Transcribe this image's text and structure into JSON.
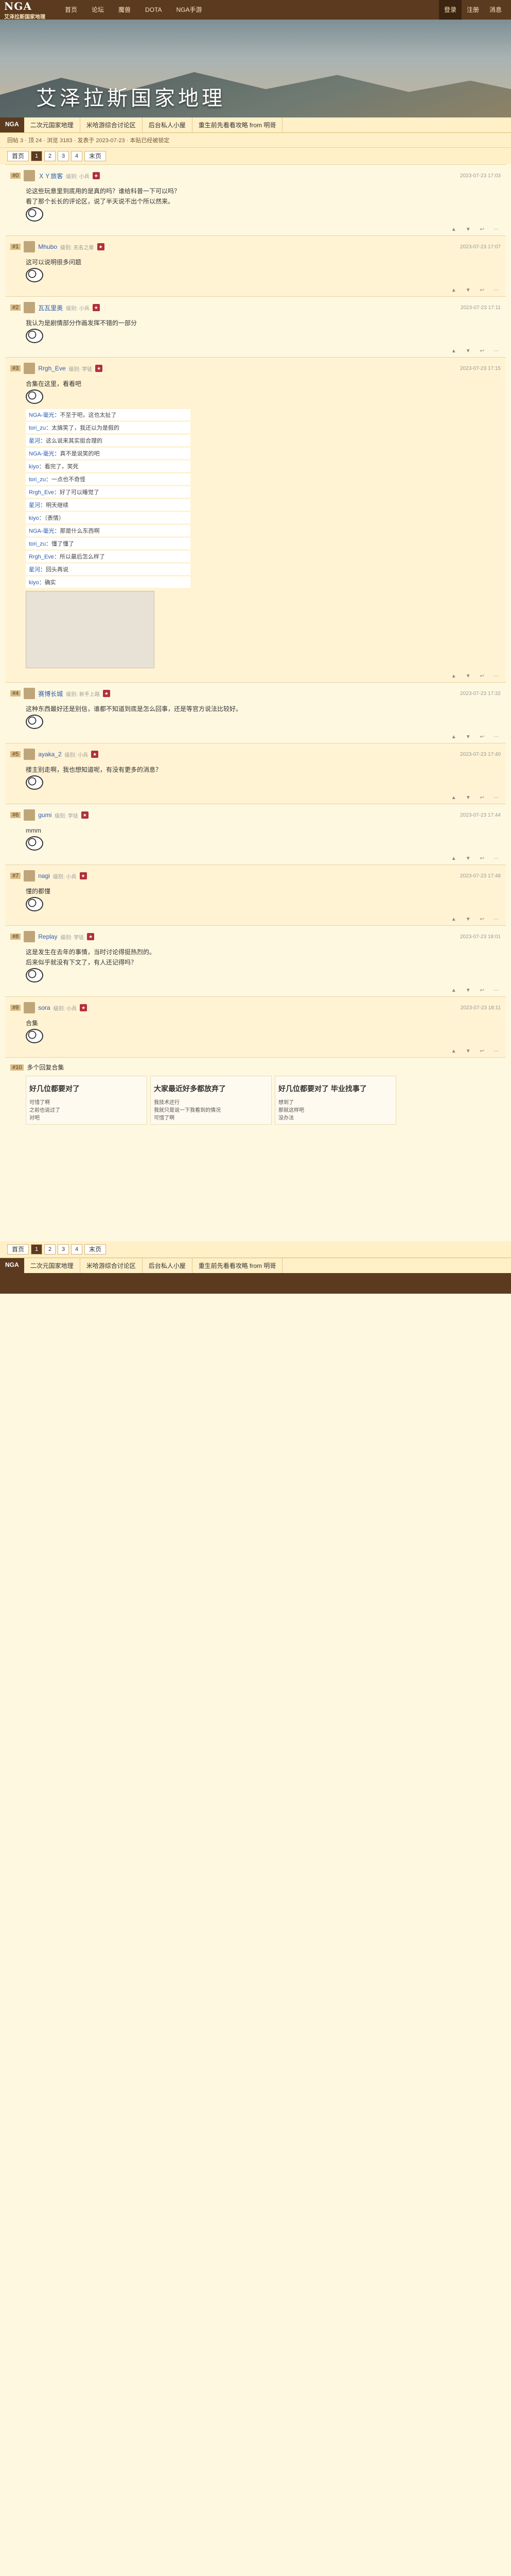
{
  "site": {
    "logo": "NGA",
    "logo_sub": "艾泽拉斯国家地理",
    "nav": [
      "首页",
      "论坛",
      "魔兽",
      "DOTA",
      "NGA手游"
    ],
    "right": [
      "登录",
      "注册",
      "消息"
    ],
    "banner_title": "艾泽拉斯国家地理"
  },
  "tabs": {
    "home": "NGA",
    "items": [
      "二次元国家地理",
      "米哈游综合讨论区",
      "后台私人小屋",
      "重生前先看看攻略 from 明哥"
    ]
  },
  "postinfo": "回帖 3 · 顶 24 · 浏览 3183 · 发表于 2023-07-23 · 本贴已经被锁定",
  "pager": {
    "first": "首页",
    "pages": [
      "1",
      "2",
      "3",
      "4"
    ],
    "last": "末页"
  },
  "posts": [
    {
      "floor": "#0",
      "user": "ＸＹ旅客",
      "level": "级别: 小兵",
      "time": "2023-07-23 17:03",
      "lines": [
        "论这些玩意里到底用的是真的吗？谁给科普一下可以吗？",
        "看了那个长长的评论区，说了半天说不出个所以然来。"
      ]
    },
    {
      "floor": "#1",
      "user": "Mhubo",
      "level": "级别: 无名之辈",
      "time": "2023-07-23 17:07",
      "lines": [
        "这可以说明很多问题"
      ]
    },
    {
      "floor": "#2",
      "user": "瓦瓦里奥",
      "level": "级别: 小兵",
      "time": "2023-07-23 17:11",
      "lines": [
        "我认为是剧情部分作画发挥不错的一部分"
      ]
    },
    {
      "floor": "#3",
      "user": "Rrgh_Eve",
      "level": "级别: 学徒",
      "time": "2023-07-23 17:15",
      "lines": [
        "合集在这里，看看吧"
      ],
      "chat": [
        [
          "NGA-毫光",
          "不至于吧，这也太扯了"
        ],
        [
          "tori_zu",
          "太搞笑了，我还以为是假的"
        ],
        [
          "星河",
          "这么说来其实挺合理的"
        ],
        [
          "NGA-毫光",
          "真不是说笑的吧"
        ],
        [
          "kiyo",
          "看完了，笑死"
        ],
        [
          "tori_zu",
          "一点也不奇怪"
        ],
        [
          "Rrgh_Eve",
          "好了可以睡觉了"
        ],
        [
          "星河",
          "明天继续"
        ],
        [
          "kiyo",
          "（表情）"
        ],
        [
          "NGA-毫光",
          "那是什么东西啊"
        ],
        [
          "tori_zu",
          "懂了懂了"
        ],
        [
          "Rrgh_Eve",
          "所以最后怎么样了"
        ],
        [
          "星河",
          "回头再说"
        ],
        [
          "kiyo",
          "确实"
        ]
      ]
    },
    {
      "floor": "#4",
      "user": "赛博长城",
      "level": "级别: 新手上路",
      "time": "2023-07-23 17:32",
      "lines": [
        "这种东西最好还是别信，谁都不知道到底是怎么回事，还是等官方说法比较好。"
      ]
    },
    {
      "floor": "#5",
      "user": "ayaka_2",
      "level": "级别: 小兵",
      "time": "2023-07-23 17:40",
      "lines": [
        "楼主别走啊，我也想知道呢，有没有更多的消息？"
      ]
    },
    {
      "floor": "#6",
      "user": "gumi",
      "level": "级别: 学徒",
      "time": "2023-07-23 17:44",
      "lines": [
        "mmm"
      ]
    },
    {
      "floor": "#7",
      "user": "nagi",
      "level": "级别: 小兵",
      "time": "2023-07-23 17:48",
      "lines": [
        "懂的都懂"
      ]
    },
    {
      "floor": "#8",
      "user": "Replay",
      "level": "级别: 学徒",
      "time": "2023-07-23 18:01",
      "lines": [
        "这是发生在去年的事情，当时讨论得挺热烈的。",
        "后来似乎就没有下文了，有人还记得吗？"
      ]
    },
    {
      "floor": "#9",
      "user": "sora",
      "level": "级别: 小兵",
      "time": "2023-07-23 18:11",
      "lines": [
        "合集"
      ]
    }
  ],
  "bigreply": {
    "header": "多个回复合集",
    "cols": [
      {
        "big": "好几位都要对了",
        "lines": [
          "可惜了啊",
          "之前也说过了",
          "对吧"
        ]
      },
      {
        "big": "大家最近好多都放弃了",
        "lines": [
          "我技术还行",
          "我就只是说一下我看到的情况",
          "可惜了啊"
        ]
      },
      {
        "big": "好几位都要对了 毕业找事了",
        "lines": [
          "想到了",
          "那就这样吧",
          "没办法"
        ]
      }
    ]
  }
}
